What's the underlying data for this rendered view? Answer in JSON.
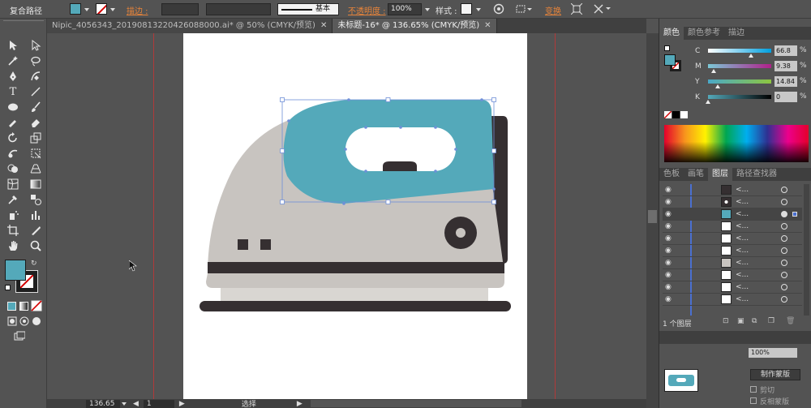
{
  "control_bar": {
    "object_type": "复合路径",
    "stroke_label": "描边 :",
    "stroke_profile": "基本",
    "opacity_label": "不透明度 :",
    "opacity_value": "100%",
    "style_label": "样式 :",
    "transform_label": "变换",
    "fill_color": "#54a9ba"
  },
  "tabs": [
    {
      "label": "Nipic_4056343_20190813220426088000.ai* @ 50% (CMYK/预览)"
    },
    {
      "label": "未标题-16* @ 136.65% (CMYK/预览)"
    }
  ],
  "status": {
    "zoom": "136.65",
    "page": "1",
    "tool_name": "选择"
  },
  "color_panel": {
    "tabs": [
      "颜色",
      "颜色参考",
      "描边"
    ],
    "channels": [
      {
        "key": "C",
        "value": "66.8",
        "pos": 0.67
      },
      {
        "key": "M",
        "value": "9.38",
        "pos": 0.09
      },
      {
        "key": "Y",
        "value": "14.84",
        "pos": 0.15
      },
      {
        "key": "K",
        "value": "0",
        "pos": 0.0
      }
    ],
    "percent": "%"
  },
  "layers_panel": {
    "tabs": [
      "色板",
      "画笔",
      "图层",
      "路径查找器"
    ],
    "row_name": "<...",
    "footer": "1 个图层"
  },
  "transparency_panel": {
    "make_mask_label": "制作蒙版",
    "clip_label": "剪切",
    "invert_label": "反相蒙版",
    "opacity_value": "100%"
  },
  "colors": {
    "accent_fill": "#54a9ba",
    "iron_body": "#c8c4c0",
    "iron_dark": "#352f31"
  }
}
